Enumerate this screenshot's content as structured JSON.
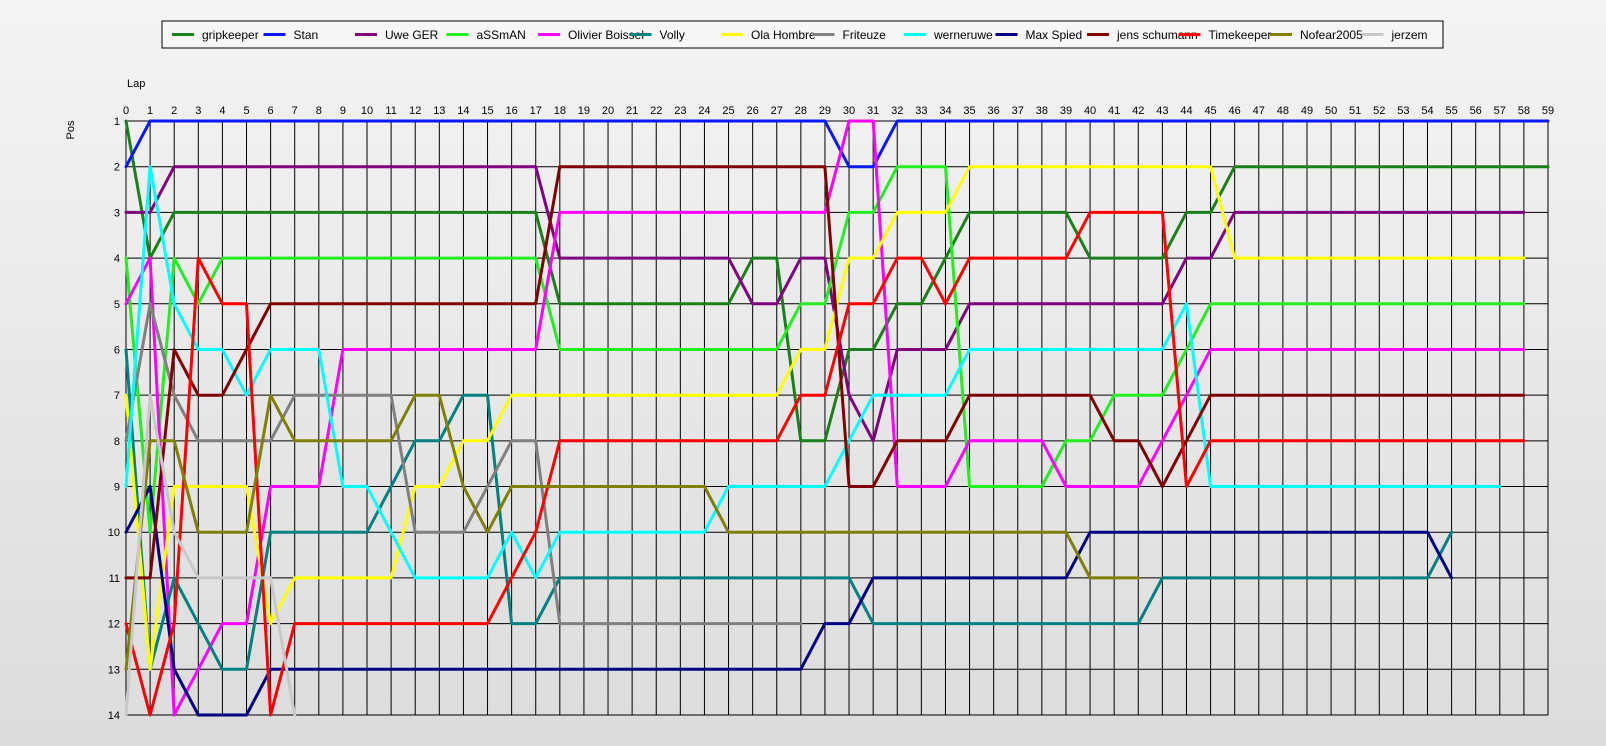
{
  "chart_data": {
    "type": "line",
    "title": "",
    "xlabel": "Lap",
    "ylabel": "Pos",
    "xlim": [
      0,
      59
    ],
    "ylim": [
      1,
      14
    ],
    "y_inverted": true,
    "grid": true,
    "legend_position": "top",
    "x_ticks": [
      0,
      1,
      2,
      3,
      4,
      5,
      6,
      7,
      8,
      9,
      10,
      11,
      12,
      13,
      14,
      15,
      16,
      17,
      18,
      19,
      20,
      21,
      22,
      23,
      24,
      25,
      26,
      27,
      28,
      29,
      30,
      31,
      32,
      33,
      34,
      35,
      36,
      37,
      38,
      39,
      40,
      41,
      42,
      43,
      44,
      45,
      46,
      47,
      48,
      49,
      50,
      51,
      52,
      53,
      54,
      55,
      56,
      57,
      58,
      59
    ],
    "y_ticks": [
      1,
      2,
      3,
      4,
      5,
      6,
      7,
      8,
      9,
      10,
      11,
      12,
      13,
      14
    ],
    "series": [
      {
        "name": "gripkeeper",
        "color": "#1a801a",
        "positions": [
          1,
          4,
          3,
          3,
          3,
          3,
          3,
          3,
          3,
          3,
          3,
          3,
          3,
          3,
          3,
          3,
          3,
          3,
          5,
          5,
          5,
          5,
          5,
          5,
          5,
          5,
          4,
          4,
          8,
          8,
          6,
          6,
          5,
          5,
          4,
          3,
          3,
          3,
          3,
          3,
          4,
          4,
          4,
          4,
          3,
          3,
          2,
          2,
          2,
          2,
          2,
          2,
          2,
          2,
          2,
          2,
          2,
          2,
          2,
          2
        ]
      },
      {
        "name": "Stan",
        "color": "#0a18ff",
        "positions": [
          2,
          1,
          1,
          1,
          1,
          1,
          1,
          1,
          1,
          1,
          1,
          1,
          1,
          1,
          1,
          1,
          1,
          1,
          1,
          1,
          1,
          1,
          1,
          1,
          1,
          1,
          1,
          1,
          1,
          1,
          2,
          2,
          1,
          1,
          1,
          1,
          1,
          1,
          1,
          1,
          1,
          1,
          1,
          1,
          1,
          1,
          1,
          1,
          1,
          1,
          1,
          1,
          1,
          1,
          1,
          1,
          1,
          1,
          1,
          1
        ]
      },
      {
        "name": "Uwe GER",
        "color": "#800080",
        "positions": [
          3,
          3,
          2,
          2,
          2,
          2,
          2,
          2,
          2,
          2,
          2,
          2,
          2,
          2,
          2,
          2,
          2,
          2,
          4,
          4,
          4,
          4,
          4,
          4,
          4,
          4,
          5,
          5,
          4,
          4,
          7,
          8,
          6,
          6,
          6,
          5,
          5,
          5,
          5,
          5,
          5,
          5,
          5,
          5,
          4,
          4,
          3,
          3,
          3,
          3,
          3,
          3,
          3,
          3,
          3,
          3,
          3,
          3,
          3
        ]
      },
      {
        "name": "aSSmAN",
        "color": "#22ee22",
        "positions": [
          4,
          10,
          4,
          5,
          4,
          4,
          4,
          4,
          4,
          4,
          4,
          4,
          4,
          4,
          4,
          4,
          4,
          4,
          6,
          6,
          6,
          6,
          6,
          6,
          6,
          6,
          6,
          6,
          5,
          5,
          3,
          3,
          2,
          2,
          2,
          9,
          9,
          9,
          9,
          8,
          8,
          7,
          7,
          7,
          6,
          5,
          5,
          5,
          5,
          5,
          5,
          5,
          5,
          5,
          5,
          5,
          5,
          5,
          5
        ]
      },
      {
        "name": "Olivier Boissel",
        "color": "#ff00ff",
        "positions": [
          5,
          4,
          14,
          13,
          12,
          12,
          9,
          9,
          9,
          6,
          6,
          6,
          6,
          6,
          6,
          6,
          6,
          6,
          3,
          3,
          3,
          3,
          3,
          3,
          3,
          3,
          3,
          3,
          3,
          3,
          1,
          1,
          9,
          9,
          9,
          8,
          8,
          8,
          8,
          9,
          9,
          9,
          9,
          8,
          7,
          6,
          6,
          6,
          6,
          6,
          6,
          6,
          6,
          6,
          6,
          6,
          6,
          6,
          6
        ]
      },
      {
        "name": "Volly",
        "color": "#008080",
        "positions": [
          6,
          13,
          11,
          12,
          13,
          13,
          10,
          10,
          10,
          10,
          10,
          9,
          8,
          8,
          7,
          7,
          12,
          12,
          11,
          11,
          11,
          11,
          11,
          11,
          11,
          11,
          11,
          11,
          11,
          11,
          11,
          12,
          12,
          12,
          12,
          12,
          12,
          12,
          12,
          12,
          12,
          12,
          12,
          11,
          11,
          11,
          11,
          11,
          11,
          11,
          11,
          11,
          11,
          11,
          11,
          10
        ]
      },
      {
        "name": "Ola Hombre",
        "color": "#ffff00",
        "positions": [
          7,
          13,
          9,
          9,
          9,
          9,
          12,
          11,
          11,
          11,
          11,
          11,
          9,
          9,
          8,
          8,
          7,
          7,
          7,
          7,
          7,
          7,
          7,
          7,
          7,
          7,
          7,
          7,
          6,
          6,
          4,
          4,
          3,
          3,
          3,
          2,
          2,
          2,
          2,
          2,
          2,
          2,
          2,
          2,
          2,
          2,
          4,
          4,
          4,
          4,
          4,
          4,
          4,
          4,
          4,
          4,
          4,
          4,
          4
        ]
      },
      {
        "name": "Friteuze",
        "color": "#808080",
        "positions": [
          8,
          5,
          7,
          8,
          8,
          8,
          8,
          7,
          7,
          7,
          7,
          7,
          10,
          10,
          10,
          9,
          8,
          8,
          12,
          12,
          12,
          12,
          12,
          12,
          12,
          12,
          12,
          12,
          12
        ]
      },
      {
        "name": "werneruwe",
        "color": "#00ffff",
        "positions": [
          9,
          2,
          5,
          6,
          6,
          7,
          6,
          6,
          6,
          9,
          9,
          10,
          11,
          11,
          11,
          11,
          10,
          11,
          10,
          10,
          10,
          10,
          10,
          10,
          10,
          9,
          9,
          9,
          9,
          9,
          8,
          7,
          7,
          7,
          7,
          6,
          6,
          6,
          6,
          6,
          6,
          6,
          6,
          6,
          5,
          9,
          9,
          9,
          9,
          9,
          9,
          9,
          9,
          9,
          9,
          9,
          9,
          9
        ]
      },
      {
        "name": "Max Spied",
        "color": "#000080",
        "positions": [
          10,
          9,
          13,
          14,
          14,
          14,
          13,
          13,
          13,
          13,
          13,
          13,
          13,
          13,
          13,
          13,
          13,
          13,
          13,
          13,
          13,
          13,
          13,
          13,
          13,
          13,
          13,
          13,
          13,
          12,
          12,
          11,
          11,
          11,
          11,
          11,
          11,
          11,
          11,
          11,
          10,
          10,
          10,
          10,
          10,
          10,
          10,
          10,
          10,
          10,
          10,
          10,
          10,
          10,
          10,
          11
        ]
      },
      {
        "name": "jens schumann",
        "color": "#800000",
        "positions": [
          11,
          11,
          6,
          7,
          7,
          6,
          5,
          5,
          5,
          5,
          5,
          5,
          5,
          5,
          5,
          5,
          5,
          5,
          2,
          2,
          2,
          2,
          2,
          2,
          2,
          2,
          2,
          2,
          2,
          2,
          9,
          9,
          8,
          8,
          8,
          7,
          7,
          7,
          7,
          7,
          7,
          8,
          8,
          9,
          8,
          7,
          7,
          7,
          7,
          7,
          7,
          7,
          7,
          7,
          7,
          7,
          7,
          7,
          7
        ]
      },
      {
        "name": "Timekeeper",
        "color": "#ff0000",
        "positions": [
          12,
          14,
          12,
          4,
          5,
          5,
          14,
          12,
          12,
          12,
          12,
          12,
          12,
          12,
          12,
          12,
          11,
          10,
          8,
          8,
          8,
          8,
          8,
          8,
          8,
          8,
          8,
          8,
          7,
          7,
          5,
          5,
          4,
          4,
          5,
          4,
          4,
          4,
          4,
          4,
          3,
          3,
          3,
          3,
          9,
          8,
          8,
          8,
          8,
          8,
          8,
          8,
          8,
          8,
          8,
          8,
          8,
          8,
          8
        ]
      },
      {
        "name": "Nofear2005",
        "color": "#808000",
        "positions": [
          13,
          8,
          8,
          10,
          10,
          10,
          7,
          8,
          8,
          8,
          8,
          8,
          7,
          7,
          9,
          10,
          9,
          9,
          9,
          9,
          9,
          9,
          9,
          9,
          9,
          10,
          10,
          10,
          10,
          10,
          10,
          10,
          10,
          10,
          10,
          10,
          10,
          10,
          10,
          10,
          11,
          11,
          11
        ]
      },
      {
        "name": "jerzem",
        "color": "#c8c8c8",
        "positions": [
          14,
          7,
          10,
          11,
          11,
          11,
          11,
          14
        ]
      }
    ]
  }
}
